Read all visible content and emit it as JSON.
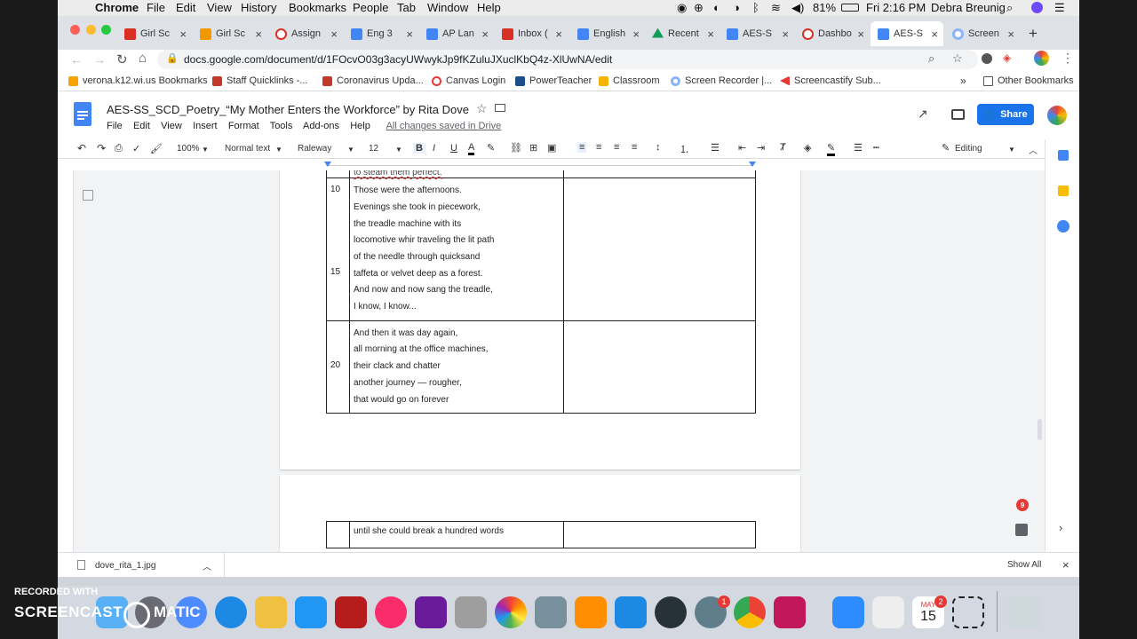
{
  "menubar": {
    "app": "Chrome",
    "items": [
      "File",
      "Edit",
      "View",
      "History",
      "Bookmarks",
      "People",
      "Tab",
      "Window",
      "Help"
    ],
    "battery": "81%",
    "clock": "Fri 2:16 PM",
    "user": "Debra Breunig"
  },
  "tabs": [
    {
      "label": "Girl Sc",
      "color": "#d93025"
    },
    {
      "label": "Girl Sc",
      "color": "#f29900"
    },
    {
      "label": "Assign",
      "color": "#d93025"
    },
    {
      "label": "Eng 3",
      "color": "#4285f4"
    },
    {
      "label": "AP Lan",
      "color": "#4285f4"
    },
    {
      "label": "Inbox (",
      "color": "#d93025"
    },
    {
      "label": "English",
      "color": "#4285f4"
    },
    {
      "label": "Recent",
      "color": "#0f9d58"
    },
    {
      "label": "AES-S",
      "color": "#4285f4"
    },
    {
      "label": "Dashbo",
      "color": "#d93025"
    },
    {
      "label": "AES-S",
      "color": "#4285f4"
    },
    {
      "label": "Screen",
      "color": "#8ab4f8"
    }
  ],
  "url": "docs.google.com/document/d/1FOcvO03g3acyUWwykJp9fKZuluJXuclKbQ4z-XlUwNA/edit",
  "bookmarks": [
    {
      "label": "verona.k12.wi.us Bookmarks",
      "color": "#f6a500"
    },
    {
      "label": "Staff Quicklinks -...",
      "color": "#c0392b"
    },
    {
      "label": "Coronavirus Upda...",
      "color": "#c0392b"
    },
    {
      "label": "Canvas Login",
      "color": "#e53935"
    },
    {
      "label": "PowerTeacher",
      "color": "#1a4f8b"
    },
    {
      "label": "Classroom",
      "color": "#f4b400"
    },
    {
      "label": "Screen Recorder |...",
      "color": "#8ab4f8"
    },
    {
      "label": "Screencastify Sub...",
      "color": "#e53935"
    }
  ],
  "other_bookmarks": "Other Bookmarks",
  "doc": {
    "title": "AES-SS_SCD_Poetry_“My Mother Enters the Workforce” by Rita Dove",
    "menus": [
      "File",
      "Edit",
      "View",
      "Insert",
      "Format",
      "Tools",
      "Add-ons",
      "Help"
    ],
    "saved": "All changes saved in Drive",
    "share": "Share"
  },
  "toolbar": {
    "zoom": "100%",
    "style": "Normal text",
    "font": "Raleway",
    "size": "12",
    "mode": "Editing"
  },
  "poem": {
    "top_fragment": "to steam them perfect.",
    "row1_num_a": "10",
    "row1_num_b": "15",
    "row1": [
      "Those were the afternoons.",
      "Evenings she took in piecework,",
      "the treadle machine with its",
      "locomotive whir traveling the lit path",
      "of the needle through quicksand",
      "taffeta or velvet deep as a forest.",
      "And now and now sang the treadle,",
      "I know, I know..."
    ],
    "row2_num": "20",
    "row2": [
      "And then it was day again,",
      "all morning at the office machines,",
      "their clack and chatter",
      "another journey — rougher,",
      "that would go on forever"
    ],
    "next_page_line": "until she could break a hundred words"
  },
  "download": {
    "file": "dove_rita_1.jpg",
    "show_all": "Show All"
  },
  "badge": "9",
  "recorded": {
    "line1": "RECORDED WITH",
    "line2": "SCREENCAST",
    "line3": "MATIC"
  },
  "dock_calendar": {
    "month": "MAY",
    "day": "15"
  },
  "dock_badges": {
    "mail": "1",
    "calendar": "2"
  }
}
